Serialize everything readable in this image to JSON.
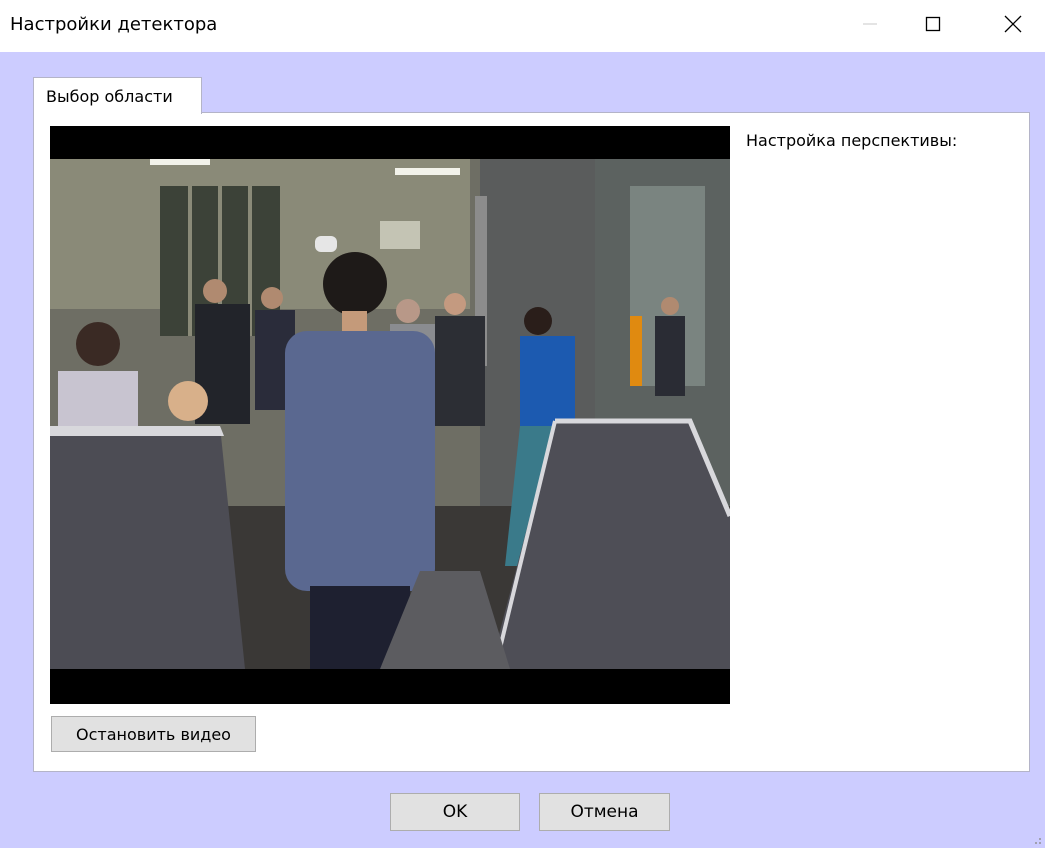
{
  "window": {
    "title": "Настройки детектора"
  },
  "tabs": [
    {
      "label": "Выбор области",
      "active": true
    }
  ],
  "panel": {
    "perspective_label": "Настройка перспективы:",
    "stop_video_label": "Остановить видео"
  },
  "dialog": {
    "ok_label": "OK",
    "cancel_label": "Отмена"
  },
  "colors": {
    "client_background": "#ccccff",
    "panel_background": "#ffffff",
    "button_face": "#e1e1e1"
  }
}
